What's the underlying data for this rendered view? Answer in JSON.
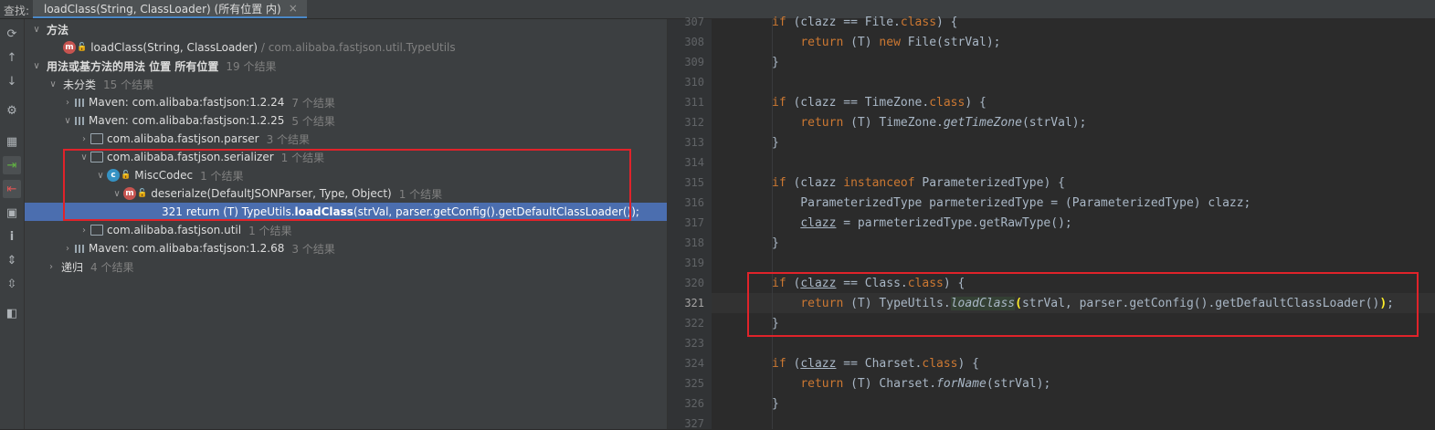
{
  "find_bar": {
    "label": "查找:",
    "tab_title": "loadClass(String, ClassLoader) (所有位置 内)",
    "close_glyph": "×"
  },
  "toolstrip": [
    {
      "icon": "refresh-icon",
      "glyph": "⟳"
    },
    {
      "icon": "arrow-up-icon",
      "glyph": "↑"
    },
    {
      "icon": "arrow-down-icon",
      "glyph": "↓"
    },
    {
      "icon": "gear-icon",
      "glyph": "⚙"
    },
    {
      "icon": "group-icon",
      "glyph": "▦"
    },
    {
      "icon": "import-icon",
      "glyph": "⇥"
    },
    {
      "icon": "export-icon",
      "glyph": "⇤"
    },
    {
      "icon": "folder-icon",
      "glyph": "▣"
    },
    {
      "icon": "info-icon",
      "glyph": "i"
    },
    {
      "icon": "expand-all-icon",
      "glyph": "⇕"
    },
    {
      "icon": "collapse-all-icon",
      "glyph": "⇳"
    },
    {
      "icon": "preview-icon",
      "glyph": "◧"
    }
  ],
  "tree": {
    "r0": {
      "text": "方法"
    },
    "r1": {
      "text": "loadClass(String, ClassLoader)",
      "extra": "/ com.alibaba.fastjson.util.TypeUtils"
    },
    "r2": {
      "text": "用法或基方法的用法 位置 所有位置",
      "count": "19 个结果"
    },
    "r3": {
      "text": "未分类",
      "count": "15 个结果"
    },
    "r4": {
      "text": "Maven: com.alibaba:fastjson:1.2.24",
      "count": "7 个结果"
    },
    "r5": {
      "text": "Maven: com.alibaba:fastjson:1.2.25",
      "count": "5 个结果"
    },
    "r6": {
      "text": "com.alibaba.fastjson.parser",
      "count": "3 个结果"
    },
    "r7": {
      "text": "com.alibaba.fastjson.serializer",
      "count": "1 个结果"
    },
    "r8": {
      "text": "MiscCodec",
      "count": "1 个结果"
    },
    "r9": {
      "text": "deserialze(DefaultJSONParser, Type, Object)",
      "count": "1 个结果"
    },
    "r10": {
      "pre": "321 return (T) TypeUtils.",
      "bold": "loadClass",
      "post": "(strVal, parser.getConfig().getDefaultClassLoader());"
    },
    "r11": {
      "text": "com.alibaba.fastjson.util",
      "count": "1 个结果"
    },
    "r12": {
      "text": "Maven: com.alibaba:fastjson:1.2.68",
      "count": "3 个结果"
    },
    "r13": {
      "text": "递归",
      "count": "4 个结果"
    }
  },
  "editor": {
    "lines": [
      "307",
      "308",
      "309",
      "310",
      "311",
      "312",
      "313",
      "314",
      "315",
      "316",
      "317",
      "318",
      "319",
      "320",
      "321",
      "322",
      "323",
      "324",
      "325",
      "326",
      "327"
    ],
    "current_line": "321"
  },
  "colors": {
    "accent": "#4a88c7",
    "selection": "#4b6eaf",
    "annotation_red": "#e0232a",
    "keyword": "#cc7832"
  }
}
